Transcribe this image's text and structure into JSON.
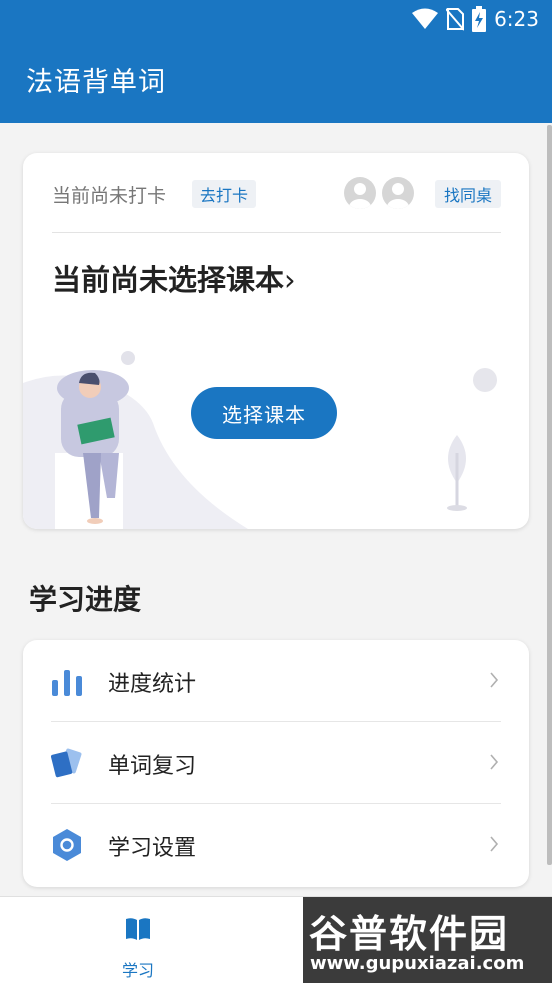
{
  "status_bar": {
    "time": "6:23"
  },
  "app": {
    "title": "法语背单词"
  },
  "checkin": {
    "status_text": "当前尚未打卡",
    "checkin_button": "去打卡",
    "find_deskmate_button": "找同桌"
  },
  "textbook": {
    "title": "当前尚未选择课本",
    "chevron": "›",
    "choose_button": "选择课本"
  },
  "progress": {
    "section_title": "学习进度",
    "items": [
      {
        "label": "进度统计",
        "icon": "bar-chart-icon"
      },
      {
        "label": "单词复习",
        "icon": "cards-icon"
      },
      {
        "label": "学习设置",
        "icon": "settings-hexagon-icon"
      }
    ]
  },
  "bottom_nav": {
    "items": [
      {
        "label": "学习",
        "icon": "book-icon",
        "active": true
      }
    ]
  },
  "watermark": {
    "title": "谷普软件园",
    "url": "www.gupuxiazai.com"
  },
  "colors": {
    "primary": "#1a76c2",
    "accent_icon": "#4a8ad8",
    "background": "#f3f3f3"
  }
}
